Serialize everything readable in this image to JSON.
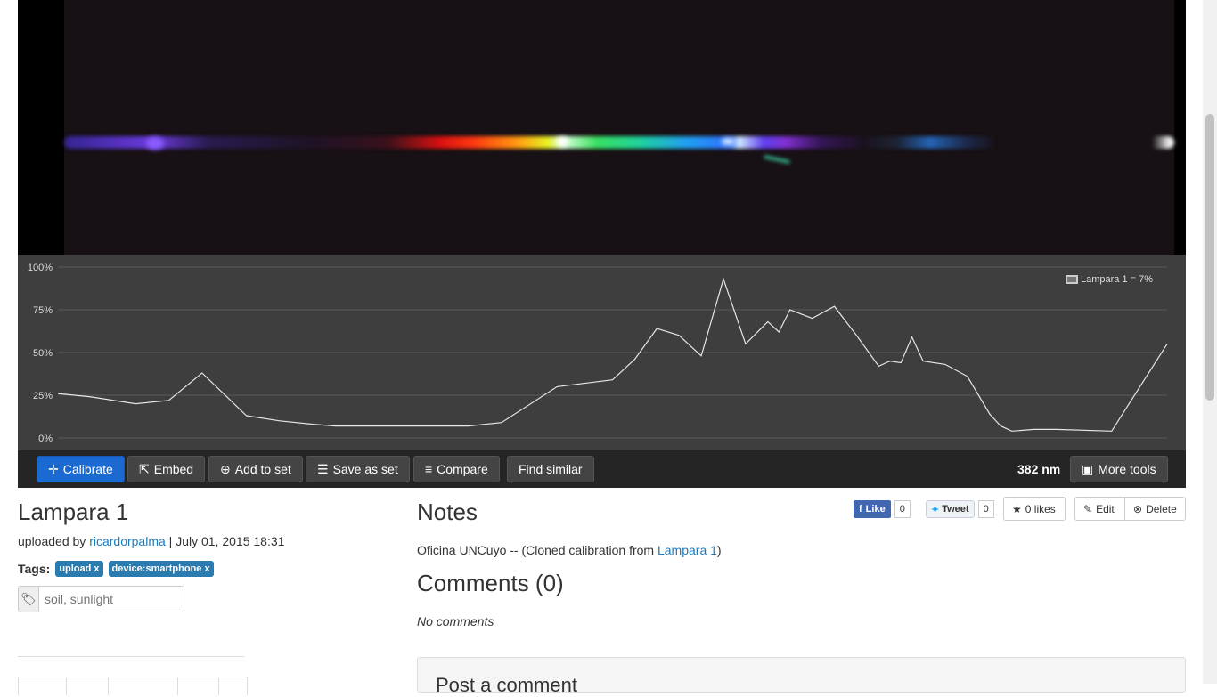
{
  "toolbar": {
    "calibrate": "Calibrate",
    "embed": "Embed",
    "add_to_set": "Add to set",
    "save_as_set": "Save as set",
    "compare": "Compare",
    "find_similar": "Find similar",
    "wavelength": "382 nm",
    "more_tools": "More tools"
  },
  "spectrum": {
    "title": "Lampara 1",
    "uploaded_prefix": "uploaded by",
    "author": "ricardorpalma",
    "date": "| July 01, 2015 18:31",
    "tags_label": "Tags:",
    "tags": [
      "upload x",
      "device:smartphone x"
    ],
    "tag_placeholder": "soil, sunlight"
  },
  "notes": {
    "heading": "Notes",
    "text_prefix": "Oficina UNCuyo -- (Cloned calibration from",
    "link": "Lampara 1",
    "text_suffix": ")"
  },
  "comments": {
    "heading": "Comments (0)",
    "empty": "No comments",
    "post_heading": "Post a comment"
  },
  "social": {
    "like": "Like",
    "like_count": "0",
    "tweet": "Tweet",
    "tweet_count": "0",
    "likes": "0 likes",
    "edit": "Edit",
    "delete": "Delete"
  },
  "chart_data": {
    "type": "line",
    "ytick_labels": [
      "100%",
      "75%",
      "50%",
      "25%",
      "0%"
    ],
    "ylim": [
      0,
      100
    ],
    "grid": true,
    "legend_position": "top-right",
    "series": [
      {
        "name": "Lampara 1 = 7%",
        "color": "#e6e6e6",
        "x": [
          0,
          3,
          7,
          10,
          13,
          17,
          20,
          23,
          25,
          27,
          30,
          33,
          37,
          40,
          45,
          50,
          52,
          54,
          56,
          57,
          58,
          60,
          62,
          64,
          65,
          66,
          68,
          70,
          72,
          74,
          75,
          76,
          77,
          78,
          80,
          82,
          84,
          85,
          86,
          88,
          90,
          95,
          100
        ],
        "values": [
          26,
          24,
          20,
          22,
          38,
          13,
          10,
          8,
          7,
          7,
          7,
          7,
          7,
          9,
          30,
          34,
          46,
          64,
          60,
          54,
          48,
          93,
          55,
          68,
          62,
          75,
          70,
          77,
          60,
          42,
          45,
          44,
          59,
          45,
          43,
          36,
          14,
          7,
          4,
          5,
          5,
          4,
          55
        ]
      }
    ]
  },
  "colors": {
    "primary_button": "#1a6ad1",
    "link": "#1a7cbf",
    "tag": "#2a7bb0"
  }
}
